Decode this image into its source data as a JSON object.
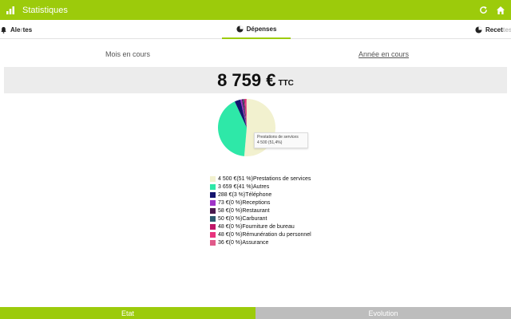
{
  "header": {
    "title": "Statistiques"
  },
  "tabs": [
    {
      "prefix": "Ale",
      "fade": "r",
      "suffix": "tes"
    },
    {
      "label": "Dépenses"
    },
    {
      "label": "Recet",
      "fade": "tes"
    }
  ],
  "period": {
    "month": "Mois en cours",
    "year": "Année en cours"
  },
  "total": {
    "amount": "8 759 €",
    "suffix": "TTC"
  },
  "tooltip": {
    "label": "Prestations de services",
    "value": "4 500 (51,4%)"
  },
  "chart_data": {
    "type": "pie",
    "categories": [
      "Prestations de services",
      "Autres",
      "Téléphone",
      "Receptions",
      "Restaurant",
      "Carburant",
      "Fourniture de bureau",
      "Rémunération du personnel",
      "Assurance"
    ],
    "values": [
      4500,
      3659,
      288,
      73,
      58,
      50,
      48,
      48,
      36
    ],
    "colors": [
      "#f2f1cf",
      "#2ee8a8",
      "#14146e",
      "#a033c8",
      "#4a1a4e",
      "#2d5a6e",
      "#c01868",
      "#e8347e",
      "#e05a8a"
    ]
  },
  "legend": [
    {
      "text": "4 500 €(51 %)Prestations de services"
    },
    {
      "text": "3 659 €(41 %)Autres"
    },
    {
      "text": "288 €(3 %)Téléphone"
    },
    {
      "text": "73 €(0 %)Receptions"
    },
    {
      "text": "58 €(0 %)Restaurant"
    },
    {
      "text": "50 €(0 %)Carburant"
    },
    {
      "text": "48 €(0 %)Fourniture de bureau"
    },
    {
      "text": "48 €(0 %)Rémunération du personnel"
    },
    {
      "text": "36 €(0 %)Assurance"
    }
  ],
  "bottom_tabs": {
    "etat": "Etat",
    "evolution": "Evolution"
  },
  "colors": {
    "accent": "#9ccb0b",
    "inactive": "#bdbdbd"
  }
}
